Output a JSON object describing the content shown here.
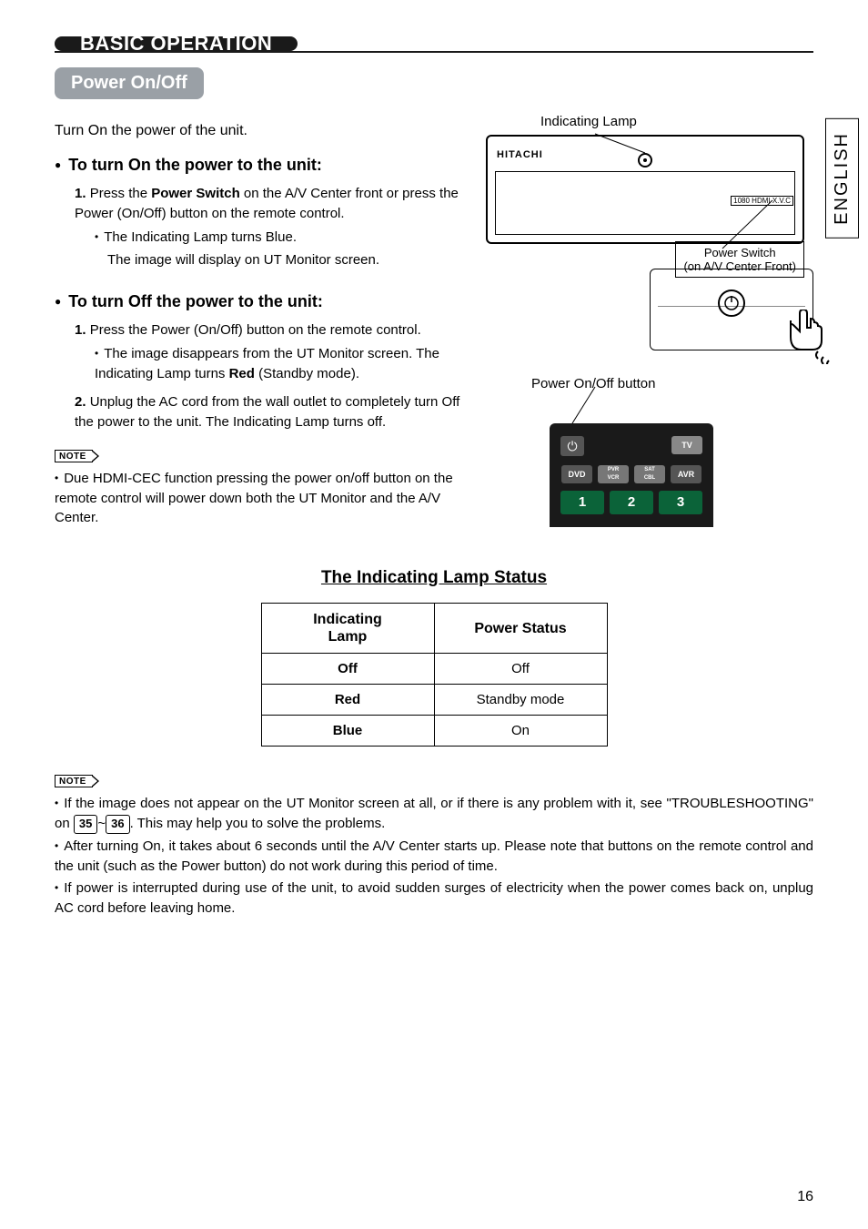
{
  "side_tab": "ENGLISH",
  "section_title": "BASIC OPERATION",
  "subsection_title": "Power On/Off",
  "intro": "Turn On the power of the unit.",
  "turn_on": {
    "heading": "To turn On the power to the unit:",
    "step1_prefix": "1.",
    "step1_a": "Press the ",
    "step1_bold": "Power Switch",
    "step1_b": " on the A/V Center front or press the Power (On/Off) button on the remote control.",
    "step1_sub1": "The Indicating Lamp turns Blue.",
    "step1_sub2": "The image will display on UT Monitor screen."
  },
  "turn_off": {
    "heading": "To turn Off the power to the unit:",
    "step1_prefix": "1.",
    "step1": "Press the Power (On/Off) button on the remote control.",
    "step1_sub_a": "The image disappears from the UT Monitor screen. The Indicating Lamp turns ",
    "step1_sub_bold": "Red",
    "step1_sub_b": " (Standby mode).",
    "step2_prefix": "2.",
    "step2": "Unplug the AC cord from the wall outlet to completely turn Off the power to the unit. The Indicating Lamp turns off."
  },
  "note1": {
    "label": "NOTE",
    "text": "Due HDMI-CEC function pressing the power on/off button on the remote control will power down both the UT Monitor and the A/V Center."
  },
  "diagram": {
    "indicating_lamp": "Indicating Lamp",
    "brand": "HITACHI",
    "badge": "1080 HDMI X.V.C",
    "power_switch_label_l1": "Power Switch",
    "power_switch_label_l2": "(on A/V Center Front)",
    "power_onoff_label": "Power On/Off button",
    "remote": {
      "tv": "TV",
      "dvd": "DVD",
      "pvr": "PVR\nVCR",
      "sat": "SAT\nCBL",
      "avr": "AVR",
      "n1": "1",
      "n2": "2",
      "n3": "3",
      "power_icon": "⏻"
    }
  },
  "lamp_table": {
    "title": "The Indicating Lamp Status",
    "head_lamp_l1": "Indicating",
    "head_lamp_l2": "Lamp",
    "head_status": "Power Status",
    "rows": [
      {
        "lamp": "Off",
        "status": "Off"
      },
      {
        "lamp": "Red",
        "status": "Standby mode"
      },
      {
        "lamp": "Blue",
        "status": "On"
      }
    ]
  },
  "note2": {
    "label": "NOTE",
    "b1_a": "If the image does not appear on the UT Monitor screen at all, or if there is any problem with it, see \"TROUBLESHOOTING\" on ",
    "p35": "35",
    "tilde": "~",
    "p36": "36",
    "b1_b": ". This may help you to solve the problems.",
    "b2": "After turning On, it takes about 6 seconds until the A/V Center starts up. Please note that buttons on the remote control and the unit (such as the Power button) do not work during this period of time.",
    "b3": "If power is interrupted during use of the unit, to avoid sudden surges of electricity when the power comes back on, unplug AC cord before leaving home."
  },
  "page_number": "16"
}
